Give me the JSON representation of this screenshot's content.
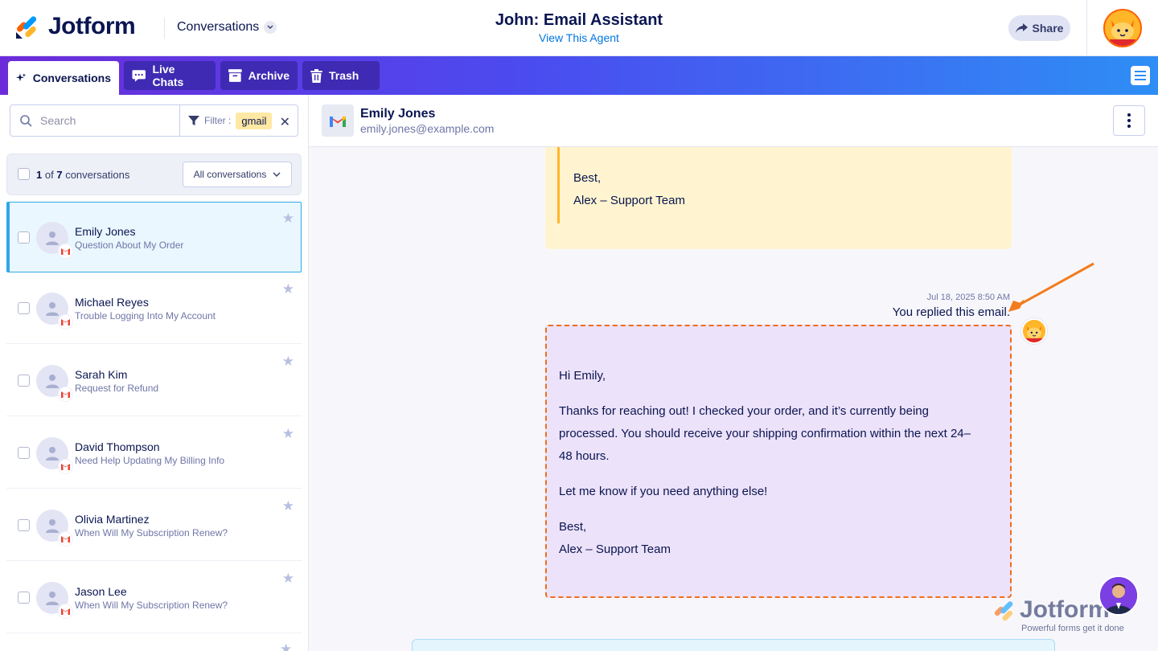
{
  "header": {
    "brand": "Jotform",
    "section_dropdown": "Conversations",
    "agent_title": "John: Email Assistant",
    "agent_link": "View This Agent",
    "share_label": "Share"
  },
  "tabs": [
    {
      "label": "Conversations",
      "icon": "sparkle-icon",
      "active": true
    },
    {
      "label": "Live Chats",
      "icon": "chat-icon",
      "active": false
    },
    {
      "label": "Archive",
      "icon": "archive-icon",
      "active": false
    },
    {
      "label": "Trash",
      "icon": "trash-icon",
      "active": false
    }
  ],
  "sidebar": {
    "search_placeholder": "Search",
    "filter_label": "Filter :",
    "filter_chip": "gmail",
    "count_current": "1",
    "count_of": "of",
    "count_total": "7",
    "count_suffix": "conversations",
    "scope_dropdown": "All conversations",
    "items": [
      {
        "name": "Emily Jones",
        "subject": "Question About My Order",
        "selected": true
      },
      {
        "name": "Michael Reyes",
        "subject": "Trouble Logging Into My Account",
        "selected": false
      },
      {
        "name": "Sarah Kim",
        "subject": "Request for Refund",
        "selected": false
      },
      {
        "name": "David Thompson",
        "subject": "Need Help Updating My Billing Info",
        "selected": false
      },
      {
        "name": "Olivia Martinez",
        "subject": "When Will My Subscription Renew?",
        "selected": false
      },
      {
        "name": "Jason Lee",
        "subject": "When Will My Subscription Renew?",
        "selected": false
      }
    ]
  },
  "conversation": {
    "contact_name": "Emily Jones",
    "contact_email": "emily.jones@example.com",
    "prev_message": {
      "closing": "Best,",
      "signature": "Alex – Support Team"
    },
    "reply": {
      "timestamp": "Jul 18, 2025 8:50 AM",
      "status": "You replied this email.",
      "greeting": "Hi Emily,",
      "body_1a": "Thanks for reaching out! I checked your order, and it’s currently being",
      "body_1b": "processed. You should receive your shipping confirmation within the next 24–",
      "body_1c": "48 hours.",
      "body_2": "Let me know if you need anything else!",
      "closing": "Best,",
      "signature": "Alex – Support Team"
    }
  },
  "watermark": {
    "brand": "Jotform",
    "tagline": "Powerful forms get it done"
  },
  "colors": {
    "brand_navy": "#0a1551",
    "accent_orange": "#f36b1c",
    "selected_blue": "#2fa8e6"
  }
}
